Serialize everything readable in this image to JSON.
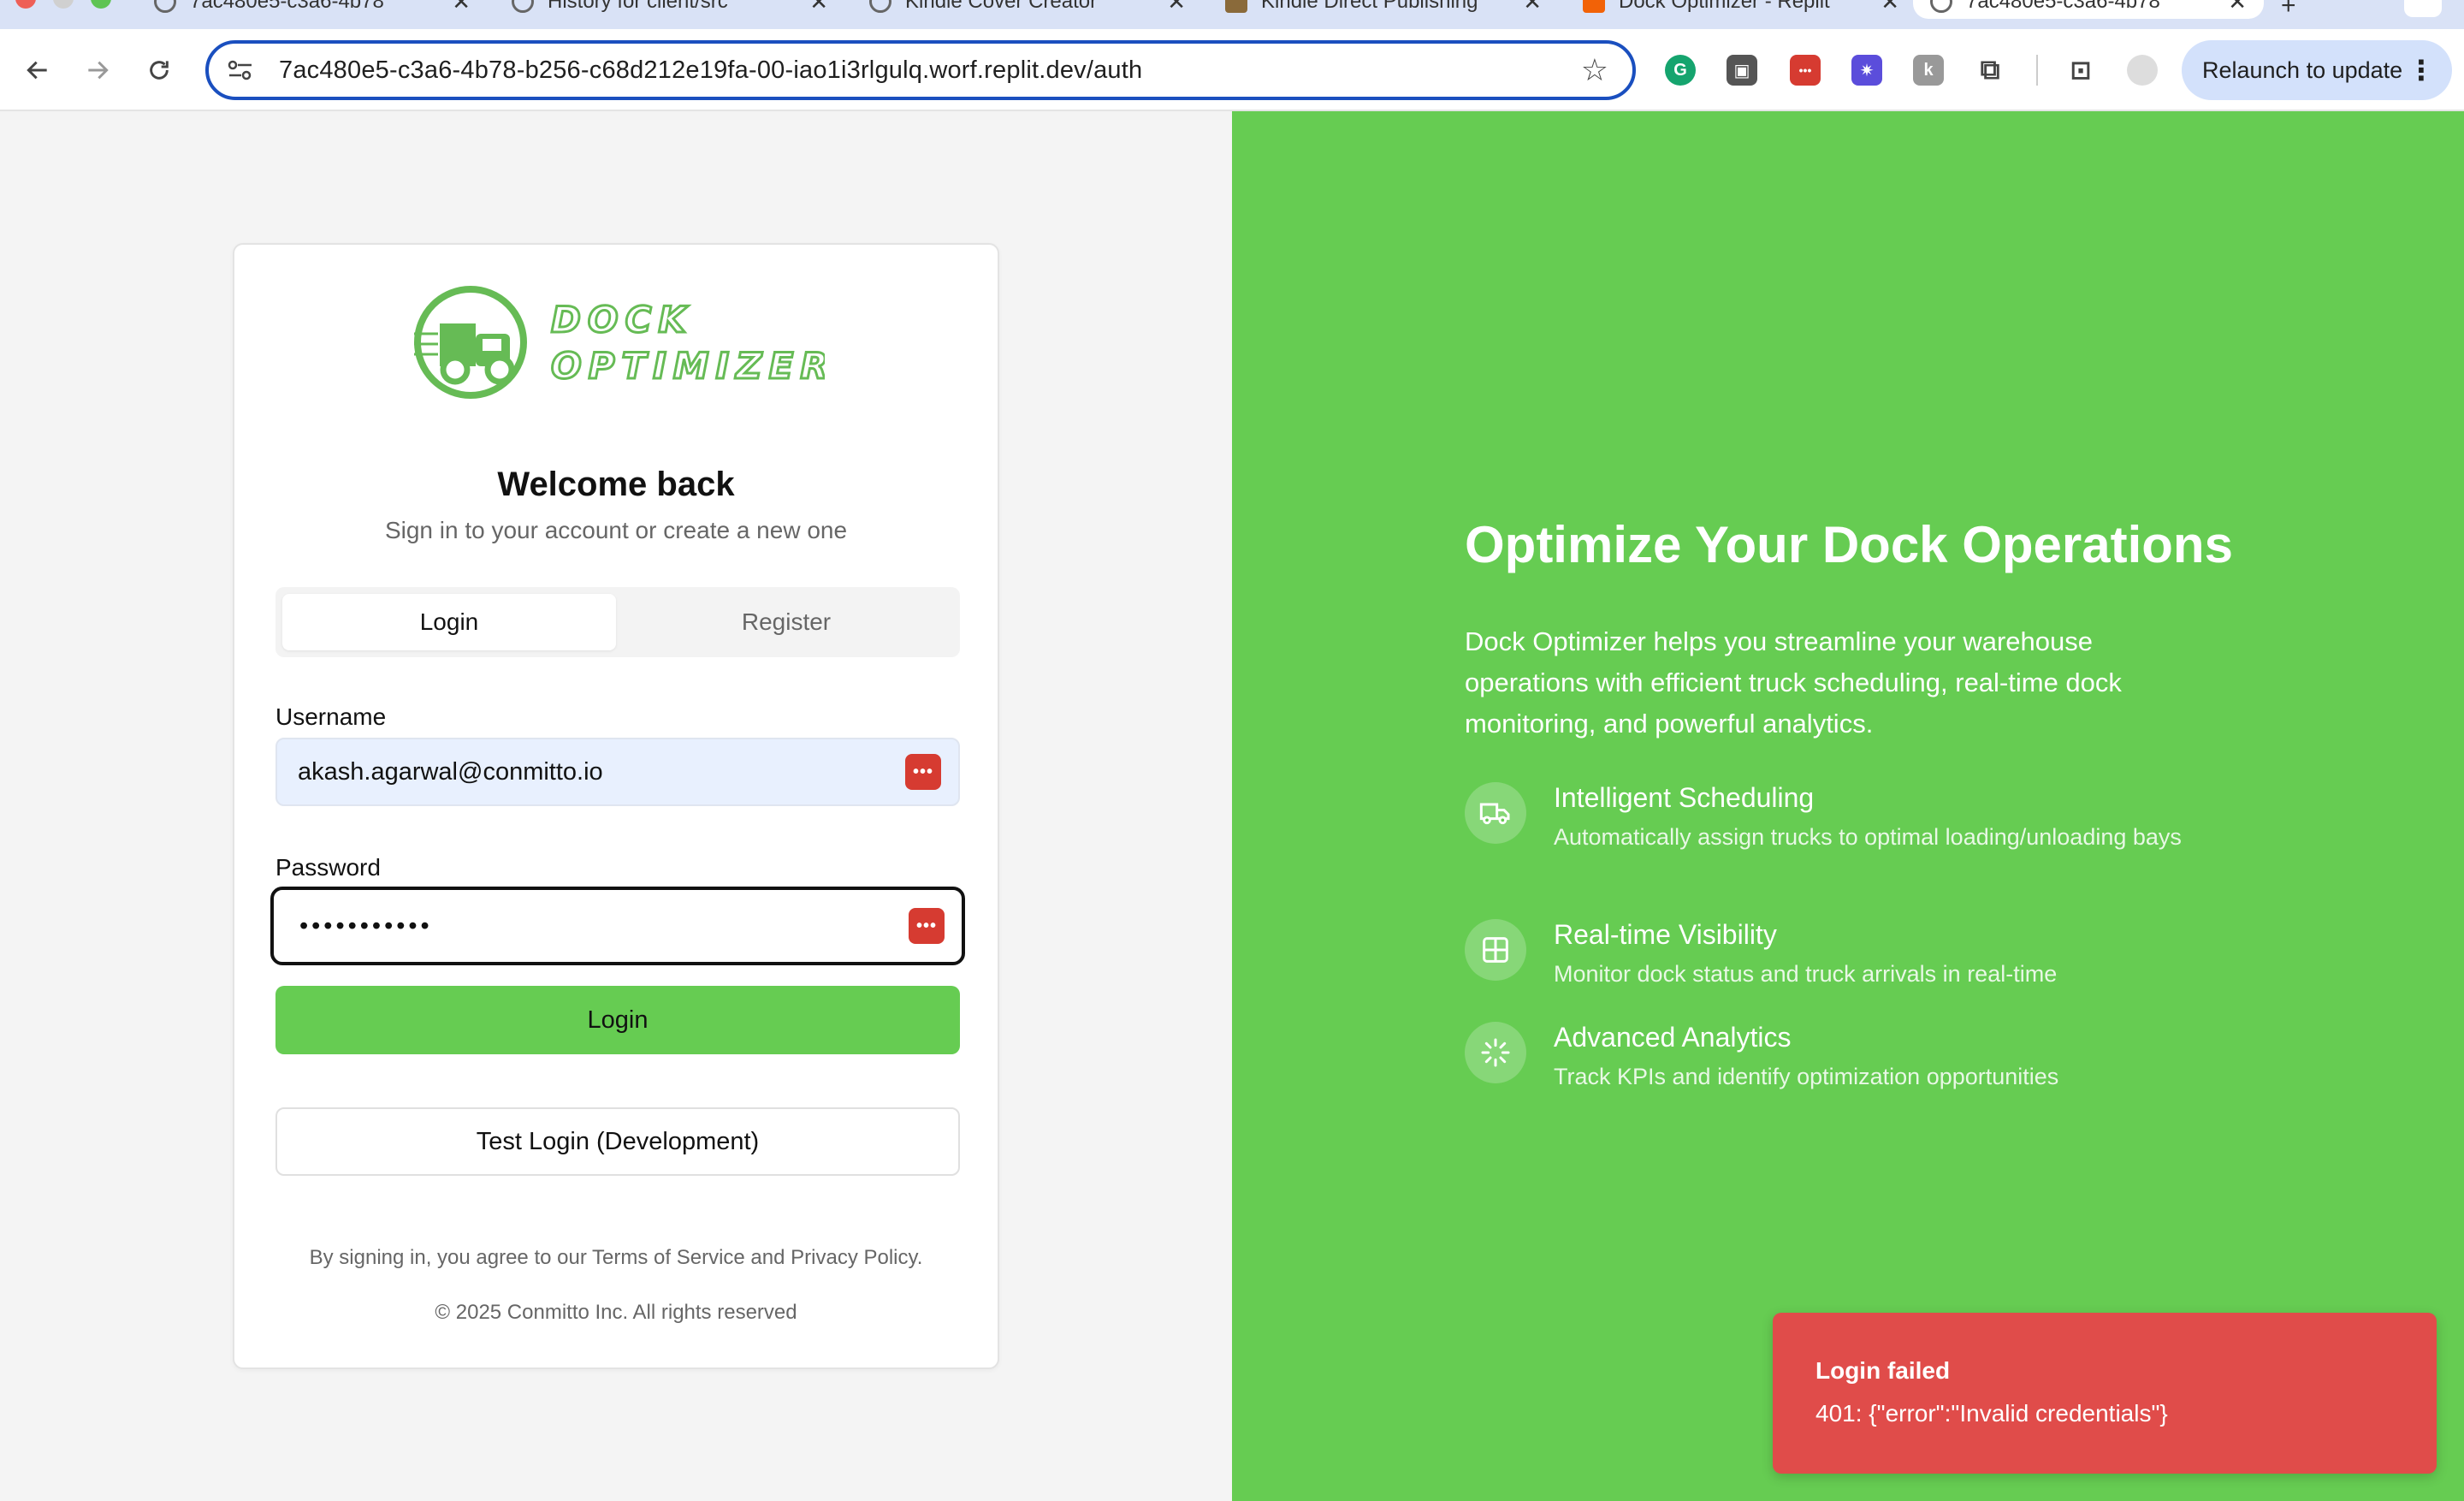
{
  "browser": {
    "tabs": [
      {
        "label": "7ac480e5-c3a6-4b78",
        "active": false
      },
      {
        "label": "History for client/src",
        "active": false
      },
      {
        "label": "Kindle Cover Creator",
        "active": false
      },
      {
        "label": "Kindle Direct Publishing",
        "active": false
      },
      {
        "label": "Dock Optimizer - Replit",
        "active": false
      },
      {
        "label": "7ac480e5-c3a6-4b78",
        "active": true
      }
    ],
    "url": "7ac480e5-c3a6-4b78-b256-c68d212e19fa-00-iao1i3rlgulq.worf.replit.dev/auth",
    "relaunch_label": "Relaunch to update",
    "extension_icons": [
      "grammarly-icon",
      "clipboard-icon",
      "password-manager-icon",
      "gear-extension-icon",
      "k-extension-icon",
      "puzzle-icon"
    ]
  },
  "login_card": {
    "logo_line1": "DOCK",
    "logo_line2": "OPTIMIZER",
    "heading": "Welcome back",
    "subheading": "Sign in to your account or create a new one",
    "tab_login": "Login",
    "tab_register": "Register",
    "username_label": "Username",
    "username_value": "akash.agarwal@conmitto.io",
    "password_label": "Password",
    "password_value": "•••••••••••",
    "login_button": "Login",
    "test_login_button": "Test Login (Development)",
    "terms": "By signing in, you agree to our Terms of Service and Privacy Policy.",
    "copyright": "© 2025 Conmitto Inc. All rights reserved"
  },
  "hero": {
    "title": "Optimize Your Dock Operations",
    "description": "Dock Optimizer helps you streamline your warehouse operations with efficient truck scheduling, real-time dock monitoring, and powerful analytics.",
    "features": [
      {
        "title": "Intelligent Scheduling",
        "description": "Automatically assign trucks to optimal loading/unloading bays",
        "icon": "truck-icon"
      },
      {
        "title": "Real-time Visibility",
        "description": "Monitor dock status and truck arrivals in real-time",
        "icon": "grid-icon"
      },
      {
        "title": "Advanced Analytics",
        "description": "Track KPIs and identify optimization opportunities",
        "icon": "loader-icon"
      }
    ]
  },
  "toast": {
    "title": "Login failed",
    "message": "401: {\"error\":\"Invalid credentials\"}"
  },
  "colors": {
    "brand_green": "#66cc52",
    "toast_red": "#e04c4a",
    "omnibox_focus": "#1a4fbf"
  }
}
